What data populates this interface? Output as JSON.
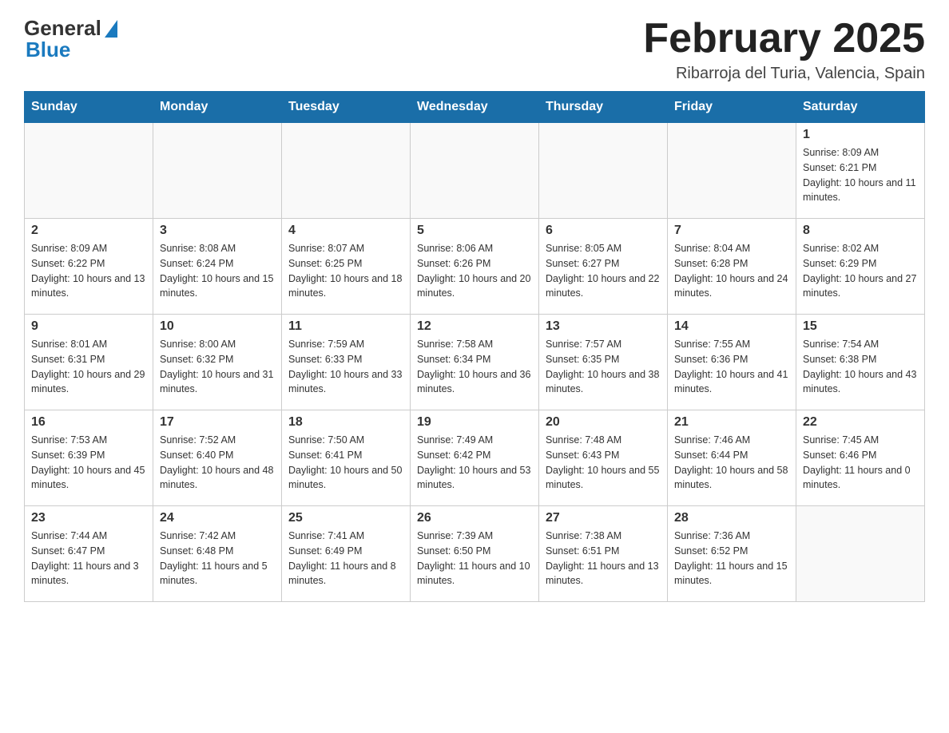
{
  "header": {
    "logo_general": "General",
    "logo_blue": "Blue",
    "month_title": "February 2025",
    "location": "Ribarroja del Turia, Valencia, Spain"
  },
  "weekdays": [
    "Sunday",
    "Monday",
    "Tuesday",
    "Wednesday",
    "Thursday",
    "Friday",
    "Saturday"
  ],
  "weeks": [
    [
      {
        "day": "",
        "sunrise": "",
        "sunset": "",
        "daylight": ""
      },
      {
        "day": "",
        "sunrise": "",
        "sunset": "",
        "daylight": ""
      },
      {
        "day": "",
        "sunrise": "",
        "sunset": "",
        "daylight": ""
      },
      {
        "day": "",
        "sunrise": "",
        "sunset": "",
        "daylight": ""
      },
      {
        "day": "",
        "sunrise": "",
        "sunset": "",
        "daylight": ""
      },
      {
        "day": "",
        "sunrise": "",
        "sunset": "",
        "daylight": ""
      },
      {
        "day": "1",
        "sunrise": "Sunrise: 8:09 AM",
        "sunset": "Sunset: 6:21 PM",
        "daylight": "Daylight: 10 hours and 11 minutes."
      }
    ],
    [
      {
        "day": "2",
        "sunrise": "Sunrise: 8:09 AM",
        "sunset": "Sunset: 6:22 PM",
        "daylight": "Daylight: 10 hours and 13 minutes."
      },
      {
        "day": "3",
        "sunrise": "Sunrise: 8:08 AM",
        "sunset": "Sunset: 6:24 PM",
        "daylight": "Daylight: 10 hours and 15 minutes."
      },
      {
        "day": "4",
        "sunrise": "Sunrise: 8:07 AM",
        "sunset": "Sunset: 6:25 PM",
        "daylight": "Daylight: 10 hours and 18 minutes."
      },
      {
        "day": "5",
        "sunrise": "Sunrise: 8:06 AM",
        "sunset": "Sunset: 6:26 PM",
        "daylight": "Daylight: 10 hours and 20 minutes."
      },
      {
        "day": "6",
        "sunrise": "Sunrise: 8:05 AM",
        "sunset": "Sunset: 6:27 PM",
        "daylight": "Daylight: 10 hours and 22 minutes."
      },
      {
        "day": "7",
        "sunrise": "Sunrise: 8:04 AM",
        "sunset": "Sunset: 6:28 PM",
        "daylight": "Daylight: 10 hours and 24 minutes."
      },
      {
        "day": "8",
        "sunrise": "Sunrise: 8:02 AM",
        "sunset": "Sunset: 6:29 PM",
        "daylight": "Daylight: 10 hours and 27 minutes."
      }
    ],
    [
      {
        "day": "9",
        "sunrise": "Sunrise: 8:01 AM",
        "sunset": "Sunset: 6:31 PM",
        "daylight": "Daylight: 10 hours and 29 minutes."
      },
      {
        "day": "10",
        "sunrise": "Sunrise: 8:00 AM",
        "sunset": "Sunset: 6:32 PM",
        "daylight": "Daylight: 10 hours and 31 minutes."
      },
      {
        "day": "11",
        "sunrise": "Sunrise: 7:59 AM",
        "sunset": "Sunset: 6:33 PM",
        "daylight": "Daylight: 10 hours and 33 minutes."
      },
      {
        "day": "12",
        "sunrise": "Sunrise: 7:58 AM",
        "sunset": "Sunset: 6:34 PM",
        "daylight": "Daylight: 10 hours and 36 minutes."
      },
      {
        "day": "13",
        "sunrise": "Sunrise: 7:57 AM",
        "sunset": "Sunset: 6:35 PM",
        "daylight": "Daylight: 10 hours and 38 minutes."
      },
      {
        "day": "14",
        "sunrise": "Sunrise: 7:55 AM",
        "sunset": "Sunset: 6:36 PM",
        "daylight": "Daylight: 10 hours and 41 minutes."
      },
      {
        "day": "15",
        "sunrise": "Sunrise: 7:54 AM",
        "sunset": "Sunset: 6:38 PM",
        "daylight": "Daylight: 10 hours and 43 minutes."
      }
    ],
    [
      {
        "day": "16",
        "sunrise": "Sunrise: 7:53 AM",
        "sunset": "Sunset: 6:39 PM",
        "daylight": "Daylight: 10 hours and 45 minutes."
      },
      {
        "day": "17",
        "sunrise": "Sunrise: 7:52 AM",
        "sunset": "Sunset: 6:40 PM",
        "daylight": "Daylight: 10 hours and 48 minutes."
      },
      {
        "day": "18",
        "sunrise": "Sunrise: 7:50 AM",
        "sunset": "Sunset: 6:41 PM",
        "daylight": "Daylight: 10 hours and 50 minutes."
      },
      {
        "day": "19",
        "sunrise": "Sunrise: 7:49 AM",
        "sunset": "Sunset: 6:42 PM",
        "daylight": "Daylight: 10 hours and 53 minutes."
      },
      {
        "day": "20",
        "sunrise": "Sunrise: 7:48 AM",
        "sunset": "Sunset: 6:43 PM",
        "daylight": "Daylight: 10 hours and 55 minutes."
      },
      {
        "day": "21",
        "sunrise": "Sunrise: 7:46 AM",
        "sunset": "Sunset: 6:44 PM",
        "daylight": "Daylight: 10 hours and 58 minutes."
      },
      {
        "day": "22",
        "sunrise": "Sunrise: 7:45 AM",
        "sunset": "Sunset: 6:46 PM",
        "daylight": "Daylight: 11 hours and 0 minutes."
      }
    ],
    [
      {
        "day": "23",
        "sunrise": "Sunrise: 7:44 AM",
        "sunset": "Sunset: 6:47 PM",
        "daylight": "Daylight: 11 hours and 3 minutes."
      },
      {
        "day": "24",
        "sunrise": "Sunrise: 7:42 AM",
        "sunset": "Sunset: 6:48 PM",
        "daylight": "Daylight: 11 hours and 5 minutes."
      },
      {
        "day": "25",
        "sunrise": "Sunrise: 7:41 AM",
        "sunset": "Sunset: 6:49 PM",
        "daylight": "Daylight: 11 hours and 8 minutes."
      },
      {
        "day": "26",
        "sunrise": "Sunrise: 7:39 AM",
        "sunset": "Sunset: 6:50 PM",
        "daylight": "Daylight: 11 hours and 10 minutes."
      },
      {
        "day": "27",
        "sunrise": "Sunrise: 7:38 AM",
        "sunset": "Sunset: 6:51 PM",
        "daylight": "Daylight: 11 hours and 13 minutes."
      },
      {
        "day": "28",
        "sunrise": "Sunrise: 7:36 AM",
        "sunset": "Sunset: 6:52 PM",
        "daylight": "Daylight: 11 hours and 15 minutes."
      },
      {
        "day": "",
        "sunrise": "",
        "sunset": "",
        "daylight": ""
      }
    ]
  ]
}
